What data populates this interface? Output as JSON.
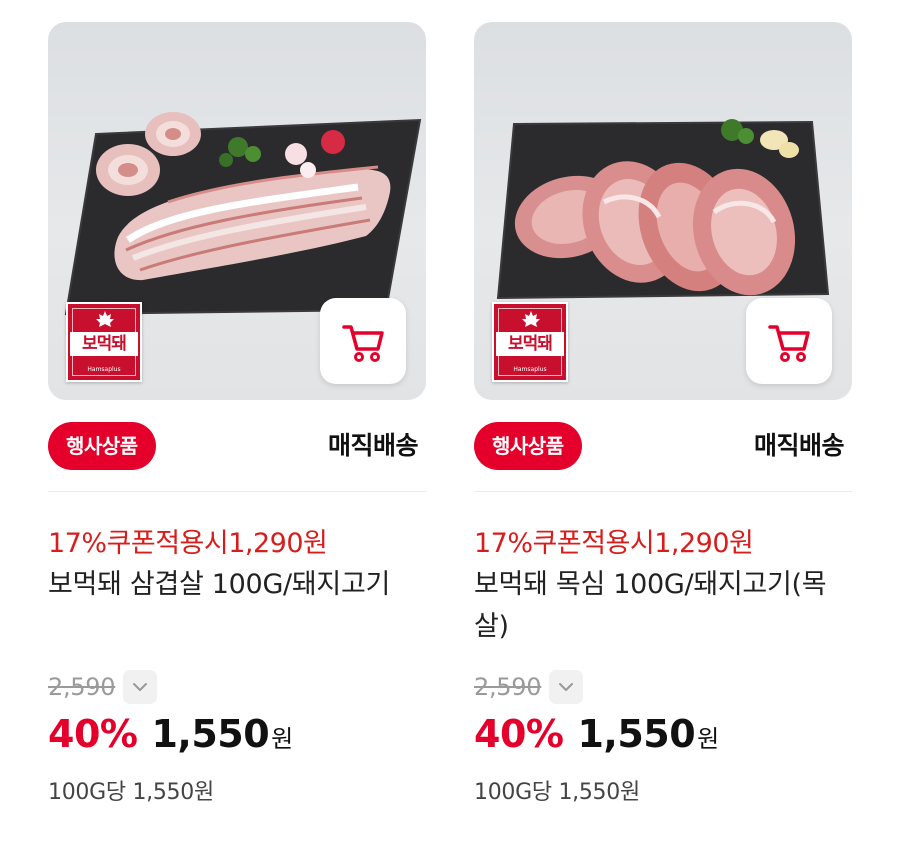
{
  "products": [
    {
      "badge_brand": "보먹돼",
      "badge_small": "Hamsaplus",
      "event_tag": "행사상품",
      "delivery": "매직배송",
      "coupon": "17%쿠폰적용시1,290원",
      "title": "보먹돼 삼겹살 100G/돼지고기",
      "original_price": "2,590",
      "discount": "40%",
      "price": "1,550",
      "currency": "원",
      "unit_price": "100G당 1,550원",
      "image_icon": "pork-belly-photo"
    },
    {
      "badge_brand": "보먹돼",
      "badge_small": "Hamsaplus",
      "event_tag": "행사상품",
      "delivery": "매직배송",
      "coupon": "17%쿠폰적용시1,290원",
      "title": "보먹돼 목심 100G/돼지고기(목살)",
      "original_price": "2,590",
      "discount": "40%",
      "price": "1,550",
      "currency": "원",
      "unit_price": "100G당 1,550원",
      "image_icon": "pork-neck-photo"
    }
  ],
  "colors": {
    "accent_red": "#e4002b",
    "coupon_red": "#d81d1d",
    "strike_gray": "#9a9a9a"
  }
}
